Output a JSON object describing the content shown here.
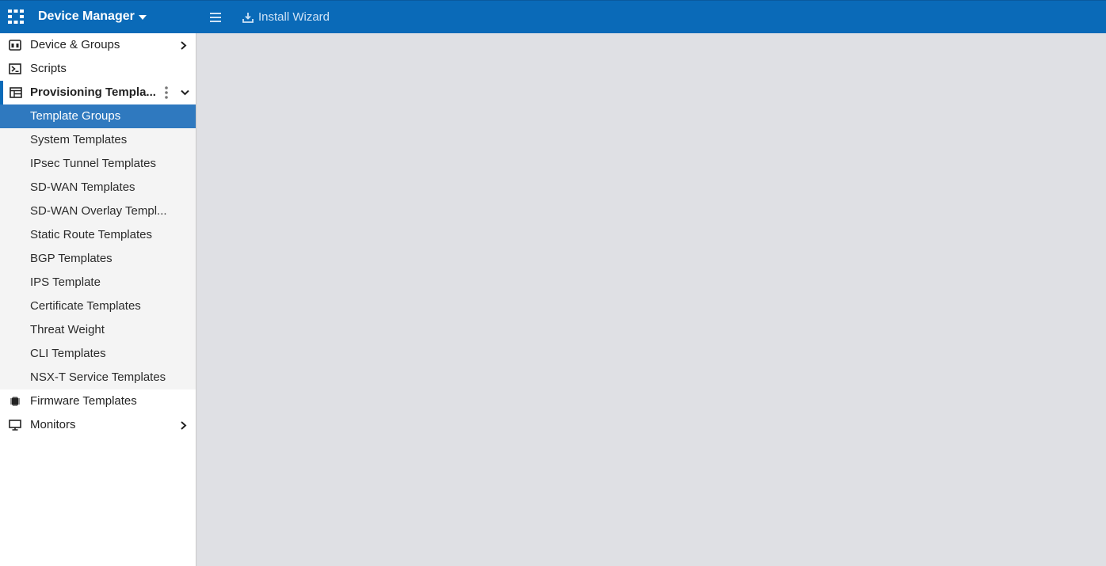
{
  "header": {
    "app_title": "Device Manager",
    "install_wizard_label": "Install Wizard",
    "bg_color": "#0a6ab8"
  },
  "sidebar": {
    "items_top": [
      {
        "label": "Device & Groups",
        "icon": "devices-icon",
        "has_submenu": true
      },
      {
        "label": "Scripts",
        "icon": "script-icon",
        "has_submenu": false
      }
    ],
    "active_section": {
      "label": "Provisioning Templa...",
      "icon": "template-icon",
      "expanded": true,
      "children": [
        {
          "label": "Template Groups",
          "selected": true
        },
        {
          "label": "System Templates",
          "selected": false
        },
        {
          "label": "IPsec Tunnel Templates",
          "selected": false
        },
        {
          "label": "SD-WAN Templates",
          "selected": false
        },
        {
          "label": "SD-WAN Overlay Templ...",
          "selected": false
        },
        {
          "label": "Static Route Templates",
          "selected": false
        },
        {
          "label": "BGP Templates",
          "selected": false
        },
        {
          "label": "IPS Template",
          "selected": false
        },
        {
          "label": "Certificate Templates",
          "selected": false
        },
        {
          "label": "Threat Weight",
          "selected": false
        },
        {
          "label": "CLI Templates",
          "selected": false
        },
        {
          "label": "NSX-T Service Templates",
          "selected": false
        }
      ]
    },
    "items_bottom": [
      {
        "label": "Firmware Templates",
        "icon": "chip-icon",
        "has_submenu": false
      },
      {
        "label": "Monitors",
        "icon": "monitor-icon",
        "has_submenu": true
      }
    ],
    "selected_color": "#2f79bf"
  }
}
